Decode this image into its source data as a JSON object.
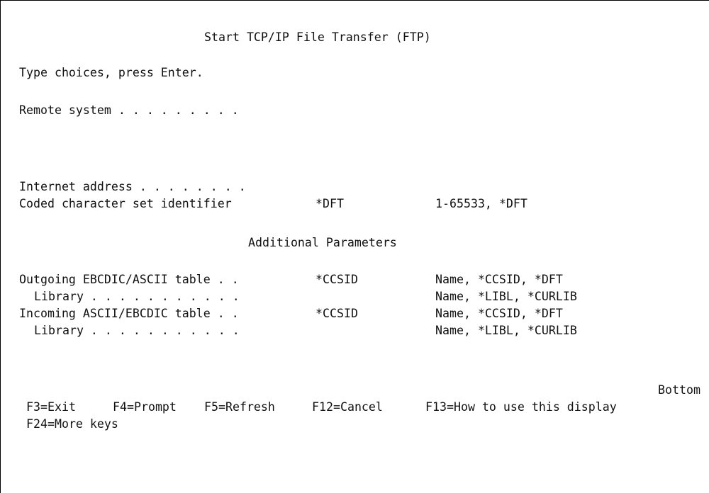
{
  "screen": {
    "title": "Start TCP/IP File Transfer (FTP)",
    "instruction": "Type choices, press Enter.",
    "section_header": "Additional Parameters",
    "position_indicator": "Bottom"
  },
  "parameters": {
    "remote_system": {
      "label": "Remote system . . . . . . . . .",
      "value": ""
    },
    "internet_address": {
      "label": "Internet address . . . . . . . .",
      "value": ""
    },
    "ccsid": {
      "label": "Coded character set identifier",
      "value": "*DFT",
      "hint": "1-65533, *DFT"
    },
    "outgoing_table": {
      "label": "Outgoing EBCDIC/ASCII table . .",
      "value": "*CCSID",
      "hint": "Name, *CCSID, *DFT"
    },
    "outgoing_library": {
      "label": "Library . . . . . . . . . . .",
      "value": "",
      "hint": "Name, *LIBL, *CURLIB"
    },
    "incoming_table": {
      "label": "Incoming ASCII/EBCDIC table . .",
      "value": "*CCSID",
      "hint": "Name, *CCSID, *DFT"
    },
    "incoming_library": {
      "label": "Library . . . . . . . . . . .",
      "value": "",
      "hint": "Name, *LIBL, *CURLIB"
    }
  },
  "function_keys": {
    "f3": "F3=Exit",
    "f4": "F4=Prompt",
    "f5": "F5=Refresh",
    "f12": "F12=Cancel",
    "f13": "F13=How to use this display",
    "f24": "F24=More keys"
  }
}
